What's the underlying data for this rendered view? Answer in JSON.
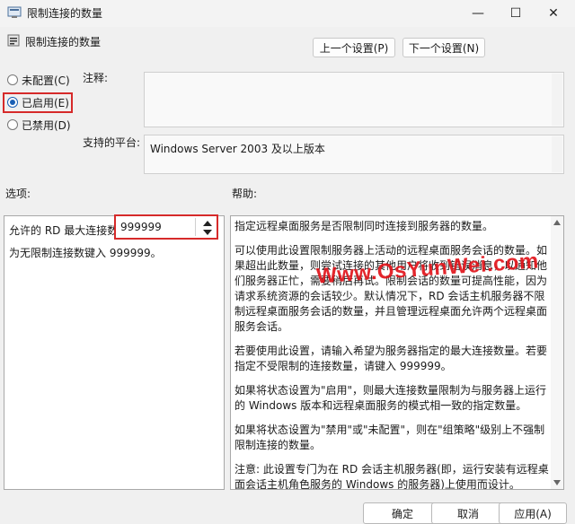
{
  "window": {
    "title": "限制连接的数量",
    "minimize_glyph": "—",
    "maximize_glyph": "☐",
    "close_glyph": "✕"
  },
  "header": {
    "policy_name": "限制连接的数量",
    "prev_button": "上一个设置(P)",
    "next_button": "下一个设置(N)"
  },
  "state_options": {
    "not_configured": "未配置(C)",
    "enabled": "已启用(E)",
    "disabled": "已禁用(D)",
    "selected": "enabled"
  },
  "comment": {
    "label": "注释:",
    "value": ""
  },
  "platform": {
    "label": "支持的平台:",
    "value": "Windows Server 2003 及以上版本"
  },
  "options": {
    "label": "选项:",
    "max_connections_label": "允许的 RD 最大连接数",
    "max_connections_value": "999999",
    "hint": "为无限制连接数键入 999999。"
  },
  "help": {
    "label": "帮助:",
    "paragraphs": [
      "指定远程桌面服务是否限制同时连接到服务器的数量。",
      "可以使用此设置限制服务器上活动的远程桌面服务会话的数量。如果超出此数量，则尝试连接的其他用户将收到错误消息，以通知他们服务器正忙，需要稍后再试。限制会话的数量可提高性能，因为请求系统资源的会话较少。默认情况下，RD 会话主机服务器不限制远程桌面服务会话的数量，并且管理远程桌面允许两个远程桌面服务会话。",
      "若要使用此设置，请输入希望为服务器指定的最大连接数量。若要指定不受限制的连接数量，请键入 999999。",
      "如果将状态设置为\"启用\"，则最大连接数量限制为与服务器上运行的 Windows 版本和远程桌面服务的模式相一致的指定数量。",
      "如果将状态设置为\"禁用\"或\"未配置\"，则在\"组策略\"级别上不强制限制连接的数量。",
      "注意: 此设置专门为在 RD 会话主机服务器(即，运行安装有远程桌面会话主机角色服务的 Windows 的服务器)上使用而设计。"
    ]
  },
  "footer": {
    "ok": "确定",
    "cancel": "取消",
    "apply": "应用(A)"
  },
  "watermark": "Www.OsYunWei.com",
  "icons": [
    "policy-icon",
    "spin-up-icon",
    "spin-down-icon",
    "scroll-up-icon",
    "scroll-down-icon"
  ]
}
